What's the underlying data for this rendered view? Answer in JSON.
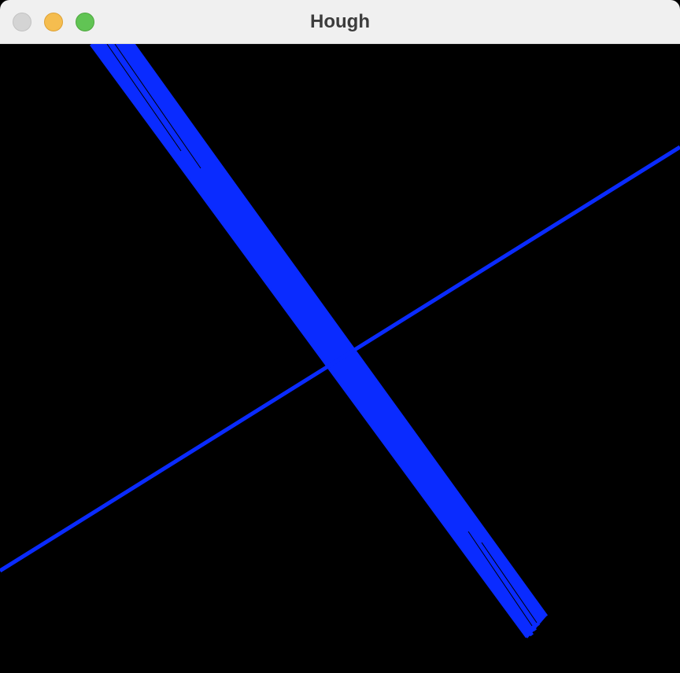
{
  "window": {
    "title": "Hough",
    "controls": [
      {
        "name": "close-button",
        "color": "#d4d4d4"
      },
      {
        "name": "minimize-button",
        "color": "#f5bd4f"
      },
      {
        "name": "zoom-button",
        "color": "#61c454"
      }
    ]
  },
  "canvas": {
    "background": "#000000",
    "line_color": "#0a2bff"
  }
}
